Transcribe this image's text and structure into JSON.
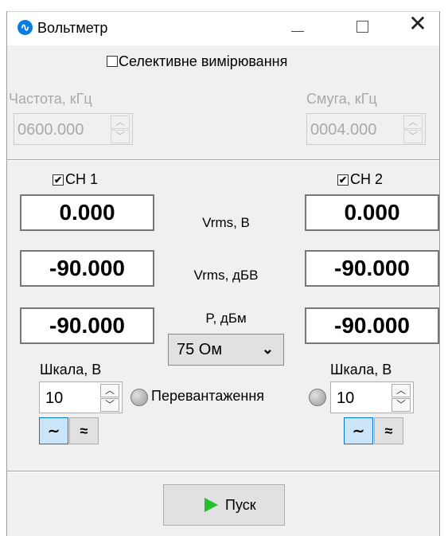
{
  "window": {
    "title": "Вольтметр"
  },
  "selective": {
    "label": "Селективне вимірювання",
    "checked": false
  },
  "frequency": {
    "label": "Частота, кГц",
    "value": "0600.000"
  },
  "bandwidth": {
    "label": "Смуга, кГц",
    "value": "0004.000"
  },
  "ch1": {
    "label": "CH 1",
    "checked": true,
    "vrms_v": "0.000",
    "vrms_dbv": "-90.000",
    "p_dbm": "-90.000",
    "scale_label": "Шкала, В",
    "scale_value": "10"
  },
  "ch2": {
    "label": "CH 2",
    "checked": true,
    "vrms_v": "0.000",
    "vrms_dbv": "-90.000",
    "p_dbm": "-90.000",
    "scale_label": "Шкала, В",
    "scale_value": "10"
  },
  "units": {
    "vrms_v": "Vrms, В",
    "vrms_dbv": "Vrms, дБВ",
    "p_dbm": "P, дБм"
  },
  "load": {
    "selected": "75 Ом"
  },
  "overload": {
    "label": "Перевантаження"
  },
  "coupling": {
    "ac_symbol": "∼",
    "dc_symbol": "≈",
    "selected": "ac"
  },
  "start_button": {
    "label": "Пуск"
  },
  "colors": {
    "accent": "#0078d7",
    "play": "#22c02a"
  }
}
